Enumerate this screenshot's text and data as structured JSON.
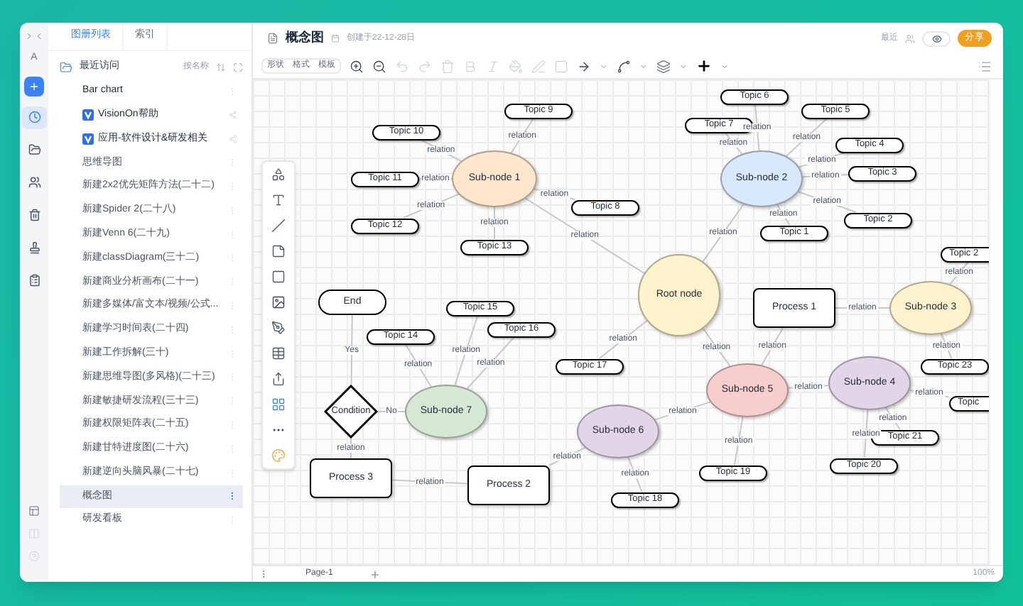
{
  "rail": {
    "letter": "A",
    "items": [
      {
        "kind": "recent",
        "selected": true
      },
      {
        "kind": "folder",
        "selected": false
      },
      {
        "kind": "shared",
        "selected": false
      },
      {
        "kind": "trash",
        "selected": false
      },
      {
        "kind": "stamp",
        "selected": false
      },
      {
        "kind": "clipboard",
        "selected": false
      }
    ]
  },
  "sidebar": {
    "tabs": [
      {
        "label": "图册列表",
        "selected": true
      },
      {
        "label": "索引",
        "selected": false
      }
    ],
    "section": "最近访问",
    "sort": "按名称",
    "items": [
      {
        "label": "Bar chart",
        "kind": "doc",
        "selected": false
      },
      {
        "label": "VisionOn帮助",
        "kind": "app",
        "selected": false
      },
      {
        "label": "应用-软件设计&研发相关",
        "kind": "app",
        "selected": false
      },
      {
        "label": "思维导图",
        "kind": "doc",
        "selected": false
      },
      {
        "label": "新建2x2优先矩阵方法(二十二)",
        "kind": "doc",
        "selected": false
      },
      {
        "label": "新建Spider 2(二十八)",
        "kind": "doc",
        "selected": false
      },
      {
        "label": "新建Venn 6(二十九)",
        "kind": "doc",
        "selected": false
      },
      {
        "label": "新建classDiagram(三十二)",
        "kind": "doc",
        "selected": false
      },
      {
        "label": "新建商业分析画布(二十一)",
        "kind": "doc",
        "selected": false
      },
      {
        "label": "新建多媒体/富文本/视频/公式...",
        "kind": "doc",
        "selected": false
      },
      {
        "label": "新建学习时间表(二十四)",
        "kind": "doc",
        "selected": false
      },
      {
        "label": "新建工作拆解(三十)",
        "kind": "doc",
        "selected": false
      },
      {
        "label": "新建思维导图(多风格)(二十三)",
        "kind": "doc",
        "selected": false
      },
      {
        "label": "新建敏捷研发流程(三十三)",
        "kind": "doc",
        "selected": false
      },
      {
        "label": "新建权限矩阵表(二十五)",
        "kind": "doc",
        "selected": false
      },
      {
        "label": "新建甘特进度图(二十六)",
        "kind": "doc",
        "selected": false
      },
      {
        "label": "新建逆向头脑风暴(二十七)",
        "kind": "doc",
        "selected": false
      },
      {
        "label": "概念图",
        "kind": "doc",
        "selected": true
      },
      {
        "label": "研发看板",
        "kind": "doc",
        "selected": false
      }
    ]
  },
  "document": {
    "title": "概念图",
    "created": "创建于22-12-28日",
    "recent": "最近",
    "share": "分享"
  },
  "toolbar": {
    "tabs": [
      "形状",
      "格式",
      "模板"
    ]
  },
  "diagram": {
    "nodes": [
      {
        "kind": "topic",
        "label": "Topic 6"
      },
      {
        "kind": "topic",
        "label": "Topic 9"
      },
      {
        "kind": "topic",
        "label": "Topic 5"
      },
      {
        "kind": "topic",
        "label": "Topic 7"
      },
      {
        "kind": "topic",
        "label": "Topic 10"
      },
      {
        "kind": "topic",
        "label": "Topic 4"
      },
      {
        "kind": "topic",
        "label": "Topic 3"
      },
      {
        "kind": "topic",
        "label": "Topic 11"
      },
      {
        "kind": "ellipse",
        "label": "Sub-node 1",
        "color": "#ffe6cc"
      },
      {
        "kind": "ellipse",
        "label": "Sub-node 2",
        "color": "#dae8fc"
      },
      {
        "kind": "topic",
        "label": "Topic 8"
      },
      {
        "kind": "topic",
        "label": "Topic 2"
      },
      {
        "kind": "topic",
        "label": "Topic 12"
      },
      {
        "kind": "topic",
        "label": "Topic 1"
      },
      {
        "kind": "topic",
        "label": "Topic 13"
      },
      {
        "kind": "topic",
        "label": "Topic 2"
      },
      {
        "kind": "ellipse",
        "label": "Root node",
        "color": "#fff2cc"
      },
      {
        "kind": "terminal",
        "label": "End"
      },
      {
        "kind": "topic",
        "label": "Topic 15"
      },
      {
        "kind": "process",
        "label": "Process 1"
      },
      {
        "kind": "ellipse",
        "label": "Sub-node 3",
        "color": "#fff2cc"
      },
      {
        "kind": "topic",
        "label": "Topic 16"
      },
      {
        "kind": "topic",
        "label": "Topic 14"
      },
      {
        "kind": "topic",
        "label": "Topic 17"
      },
      {
        "kind": "topic",
        "label": "Topic 23"
      },
      {
        "kind": "ellipse",
        "label": "Sub-node 4",
        "color": "#e1d5e7"
      },
      {
        "kind": "ellipse",
        "label": "Sub-node 5",
        "color": "#f8cecc"
      },
      {
        "kind": "topic",
        "label": "Topic"
      },
      {
        "kind": "decision",
        "label": "Condition"
      },
      {
        "kind": "ellipse",
        "label": "Sub-node 7",
        "color": "#d5e8d4"
      },
      {
        "kind": "ellipse",
        "label": "Sub-node 6",
        "color": "#e1d5e7"
      },
      {
        "kind": "topic",
        "label": "Topic 21"
      },
      {
        "kind": "topic",
        "label": "Topic 20"
      },
      {
        "kind": "topic",
        "label": "Topic 19"
      },
      {
        "kind": "process",
        "label": "Process 3"
      },
      {
        "kind": "process",
        "label": "Process 2"
      },
      {
        "kind": "topic",
        "label": "Topic 18"
      }
    ],
    "edges": [
      {
        "label": "relation"
      },
      {
        "label": "relation"
      },
      {
        "label": "relation"
      },
      {
        "label": "relation"
      },
      {
        "label": "relation"
      },
      {
        "label": "relation"
      },
      {
        "label": "relation"
      },
      {
        "label": "relation"
      },
      {
        "label": "relation"
      },
      {
        "label": "relation"
      },
      {
        "label": "relation"
      },
      {
        "label": "relation"
      },
      {
        "label": "relation"
      },
      {
        "label": "relation"
      },
      {
        "label": "relation"
      },
      {
        "label": "relation"
      },
      {
        "label": "relation"
      },
      {
        "label": "Yes"
      },
      {
        "label": "relation"
      },
      {
        "label": "relation"
      },
      {
        "label": "relation"
      },
      {
        "label": "relation"
      },
      {
        "label": "relation"
      },
      {
        "label": "relation"
      },
      {
        "label": "relation"
      },
      {
        "label": "relation"
      },
      {
        "label": "relation"
      },
      {
        "label": "relation"
      },
      {
        "label": "relation"
      },
      {
        "label": "No"
      },
      {
        "label": "relation"
      },
      {
        "label": "relation"
      },
      {
        "label": "relation"
      },
      {
        "label": "relation"
      },
      {
        "label": "relation"
      },
      {
        "label": "relation"
      }
    ]
  },
  "footer": {
    "page": "Page-1",
    "zoom": "100%"
  }
}
